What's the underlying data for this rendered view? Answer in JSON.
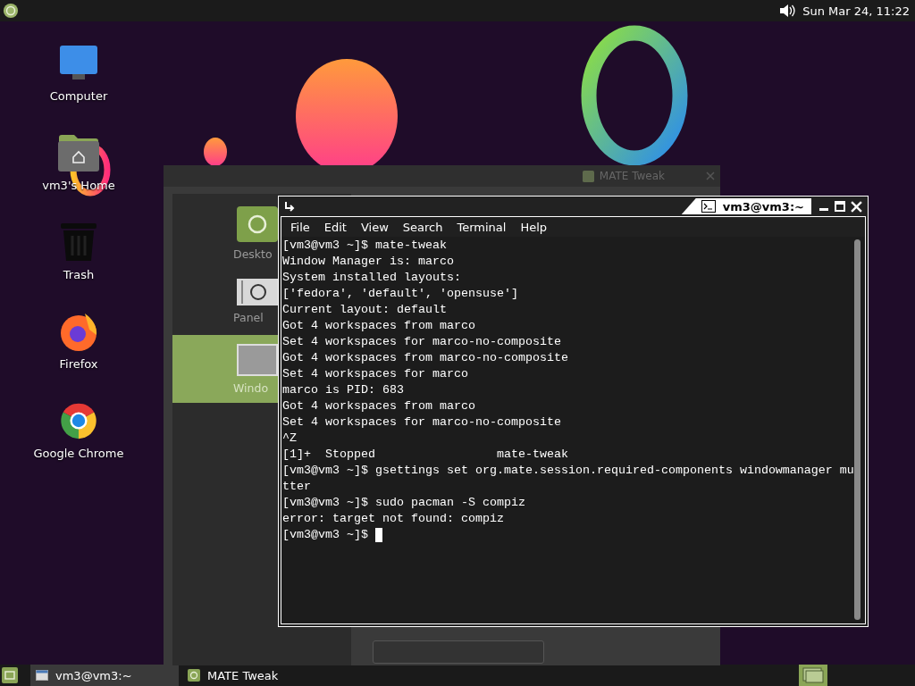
{
  "top_panel": {
    "clock": "Sun Mar 24, 11:22"
  },
  "desktop_icons": [
    {
      "label": "Computer",
      "kind": "computer"
    },
    {
      "label": "vm3's Home",
      "kind": "home"
    },
    {
      "label": "Trash",
      "kind": "trash"
    },
    {
      "label": "Firefox",
      "kind": "firefox"
    },
    {
      "label": "Google Chrome",
      "kind": "chrome"
    }
  ],
  "tweak_window": {
    "title": "MATE Tweak",
    "sidebar": [
      {
        "label": "Deskto",
        "kind": "desktop",
        "selected": false
      },
      {
        "label": "Panel",
        "kind": "panel",
        "selected": false
      },
      {
        "label": "Windo",
        "kind": "windows",
        "selected": true
      }
    ]
  },
  "terminal": {
    "title": "vm3@vm3:~",
    "menu": [
      "File",
      "Edit",
      "View",
      "Search",
      "Terminal",
      "Help"
    ],
    "lines": [
      "[vm3@vm3 ~]$ mate-tweak",
      "Window Manager is: marco",
      "System installed layouts:",
      "['fedora', 'default', 'opensuse']",
      "Current layout: default",
      "Got 4 workspaces from marco",
      "Set 4 workspaces for marco-no-composite",
      "Got 4 workspaces from marco-no-composite",
      "Set 4 workspaces for marco",
      "marco is PID: 683",
      "Got 4 workspaces from marco",
      "Set 4 workspaces for marco-no-composite",
      "^Z",
      "[1]+  Stopped                 mate-tweak",
      "[vm3@vm3 ~]$ gsettings set org.mate.session.required-components windowmanager mu",
      "tter",
      "[vm3@vm3 ~]$ sudo pacman -S compiz",
      "error: target not found: compiz",
      "[vm3@vm3 ~]$ "
    ]
  },
  "taskbar": {
    "tasks": [
      {
        "label": "vm3@vm3:~",
        "kind": "terminal",
        "selected": true
      },
      {
        "label": "MATE Tweak",
        "kind": "tweak",
        "selected": false
      }
    ]
  }
}
